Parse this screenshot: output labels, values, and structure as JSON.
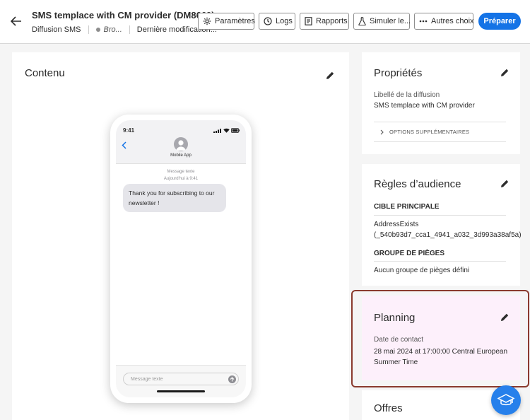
{
  "header": {
    "title": "SMS templace with CM provider (DM8669)",
    "channel": "Diffusion SMS",
    "status": "Bro...",
    "last_modified": "Dernière modification...",
    "buttons": {
      "settings": "Paramètres",
      "logs": "Logs",
      "reports": "Rapports",
      "simulate": "Simuler le...",
      "more": "Autres choix",
      "prepare": "Préparer"
    }
  },
  "content": {
    "title": "Contenu",
    "phone": {
      "time": "9:41",
      "app_name": "Mobile App",
      "message_type": "Message texte",
      "message_time": "Aujourd'hui à 9:41",
      "message": "Thank you for subscribing to our newsletter !",
      "input_placeholder": "Message texte"
    }
  },
  "properties": {
    "title": "Propriétés",
    "label": "Libellé de la diffusion",
    "value": "SMS templace with CM provider",
    "options": "OPTIONS SUPPLÉMENTAIRES"
  },
  "audience": {
    "title": "Règles d’audience",
    "main_target_header": "CIBLE PRINCIPALE",
    "main_target_line1": "AddressExists",
    "main_target_line2": "(_540b93d7_cca1_4941_a032_3d993a38af5a)",
    "traps_header": "GROUPE DE PIÈGES",
    "traps_value": "Aucun groupe de pièges défini"
  },
  "planning": {
    "title": "Planning",
    "label": "Date de contact",
    "value_line1": "28 mai 2024 at  17:00:00 Central European",
    "value_line2": "Summer Time"
  },
  "offers": {
    "title": "Offres"
  },
  "colors": {
    "primary": "#1473e6",
    "highlight": "#8a3b2e",
    "planning_bg": "#fdf0fb"
  }
}
